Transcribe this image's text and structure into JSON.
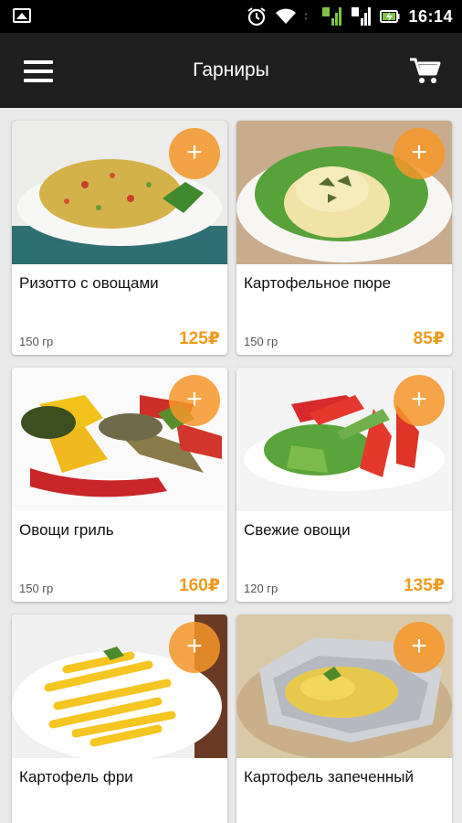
{
  "status_bar": {
    "time": "16:14"
  },
  "app_bar": {
    "title": "Гарниры"
  },
  "colors": {
    "accent": "#f09a1f",
    "app_bar": "#1f1f1f",
    "status_bar": "#000000",
    "background": "#e9e9e9"
  },
  "add_label": "+",
  "products": [
    {
      "name": "Ризотто с овощами",
      "weight": "150 гр",
      "price": "125₽"
    },
    {
      "name": "Картофельное пюре",
      "weight": "150 гр",
      "price": "85₽"
    },
    {
      "name": "Овощи гриль",
      "weight": "150 гр",
      "price": "160₽"
    },
    {
      "name": "Свежие овощи",
      "weight": "120 гр",
      "price": "135₽"
    },
    {
      "name": "Картофель фри",
      "weight": "",
      "price": ""
    },
    {
      "name": "Картофель запеченный",
      "weight": "",
      "price": ""
    }
  ]
}
